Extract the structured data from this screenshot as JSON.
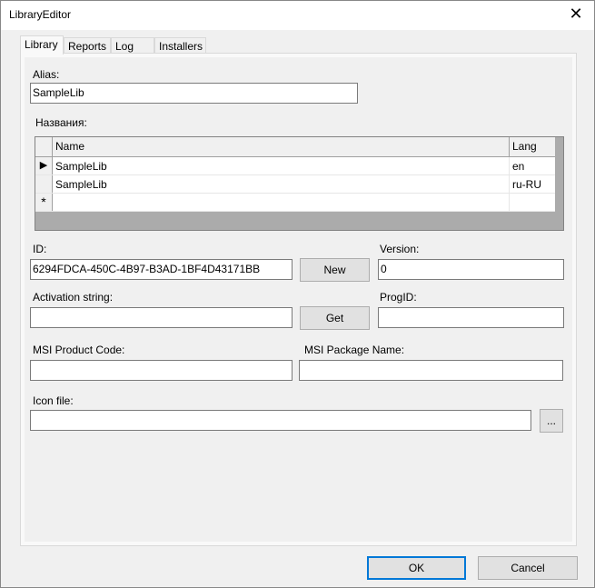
{
  "window": {
    "title": "LibraryEditor",
    "close_icon": "close-icon"
  },
  "tabs": [
    {
      "label": "Library",
      "active": true
    },
    {
      "label": "Reports"
    },
    {
      "label": "Log"
    },
    {
      "label": "Installers"
    }
  ],
  "alias": {
    "label": "Alias:",
    "value": "SampleLib"
  },
  "names": {
    "label": "Названия:",
    "columns": [
      "Name",
      "Lang"
    ],
    "rows": [
      {
        "name": "SampleLib",
        "lang": "en",
        "current": true
      },
      {
        "name": "SampleLib",
        "lang": "ru-RU"
      }
    ],
    "new_row_marker": "*"
  },
  "id": {
    "label": "ID:",
    "value": "6294FDCA-450C-4B97-B3AD-1BF4D43171BB",
    "new_button": "New"
  },
  "version": {
    "label": "Version:",
    "value": "0"
  },
  "activation": {
    "label": "Activation string:",
    "value": "",
    "get_button": "Get"
  },
  "progid": {
    "label": "ProgID:",
    "value": ""
  },
  "msi_product_code": {
    "label": "MSI Product Code:",
    "value": ""
  },
  "msi_package_name": {
    "label": "MSI Package Name:",
    "value": ""
  },
  "icon_file": {
    "label": "Icon file:",
    "value": "",
    "browse_button": "..."
  },
  "footer": {
    "ok": "OK",
    "cancel": "Cancel"
  }
}
